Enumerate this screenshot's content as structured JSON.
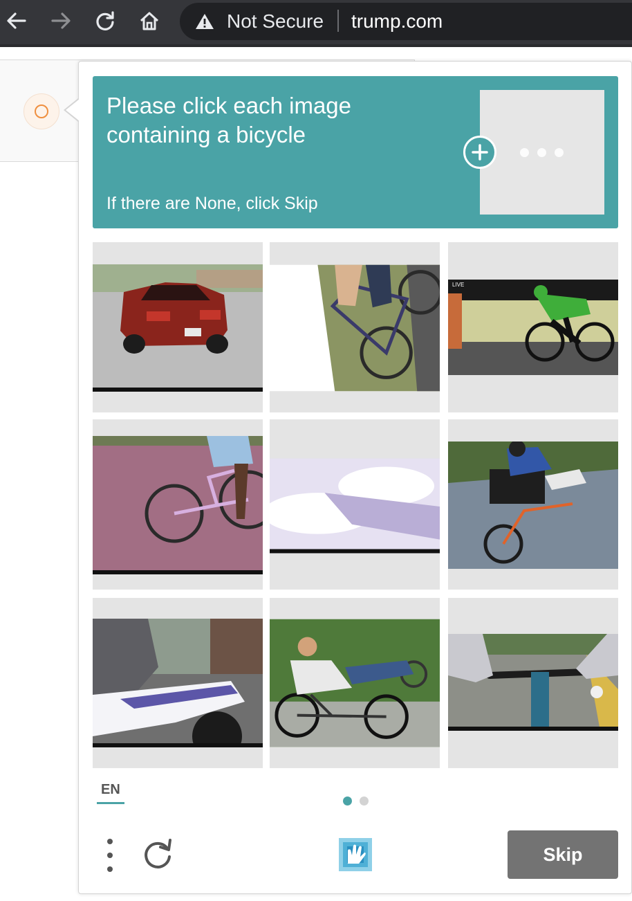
{
  "browser": {
    "security_label": "Not Secure",
    "url": "trump.com",
    "icons": [
      "back-arrow-icon",
      "forward-arrow-icon",
      "reload-icon",
      "home-icon",
      "warning-icon"
    ]
  },
  "challenge": {
    "prompt": "Please click each image containing a bicycle",
    "instruction": "If there are None, click Skip",
    "images": [
      "red car in parking lot",
      "sideways cyclist on road",
      "cyclist in race broadcast",
      "person on purple bicycle",
      "airplane wing over clouds",
      "recumbent trike rider",
      "motorcycle rider",
      "person on recumbent bicycle",
      "handlebar view of bicycle"
    ],
    "language": "EN",
    "page_count": 2,
    "current_page": 1,
    "skip_label": "Skip"
  },
  "colors": {
    "accent": "#4aa3a6",
    "toolbar": "#35363a",
    "skip": "#737373"
  }
}
